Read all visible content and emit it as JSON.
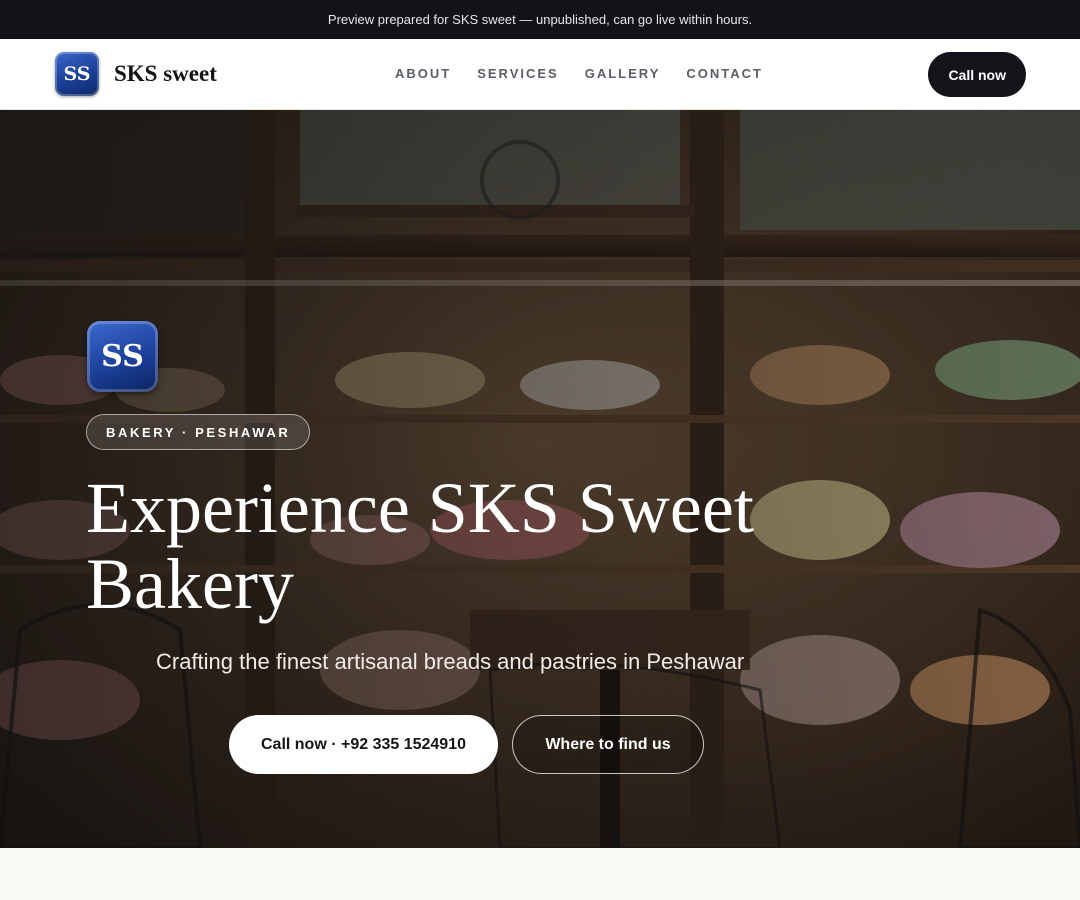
{
  "preview_banner": {
    "text": "Preview prepared for SKS sweet — unpublished, can go live within hours."
  },
  "header": {
    "logo_initials": "SS",
    "brand_name": "SKS sweet",
    "nav": [
      {
        "label": "ABOUT"
      },
      {
        "label": "SERVICES"
      },
      {
        "label": "GALLERY"
      },
      {
        "label": "CONTACT"
      }
    ],
    "cta_label": "Call now"
  },
  "hero": {
    "logo_initials": "SS",
    "badge": "BAKERY · PESHAWAR",
    "title_line1": "Experience SKS Sweet",
    "title_line2": "Bakery",
    "subtitle": "Crafting the finest artisanal breads and pastries in Peshawar",
    "primary_button": "Call now · +92 335 1524910",
    "secondary_button": "Where to find us"
  },
  "colors": {
    "accent_blue": "#1c419b",
    "dark": "#14151a",
    "page_bg": "#f9f8f5"
  }
}
